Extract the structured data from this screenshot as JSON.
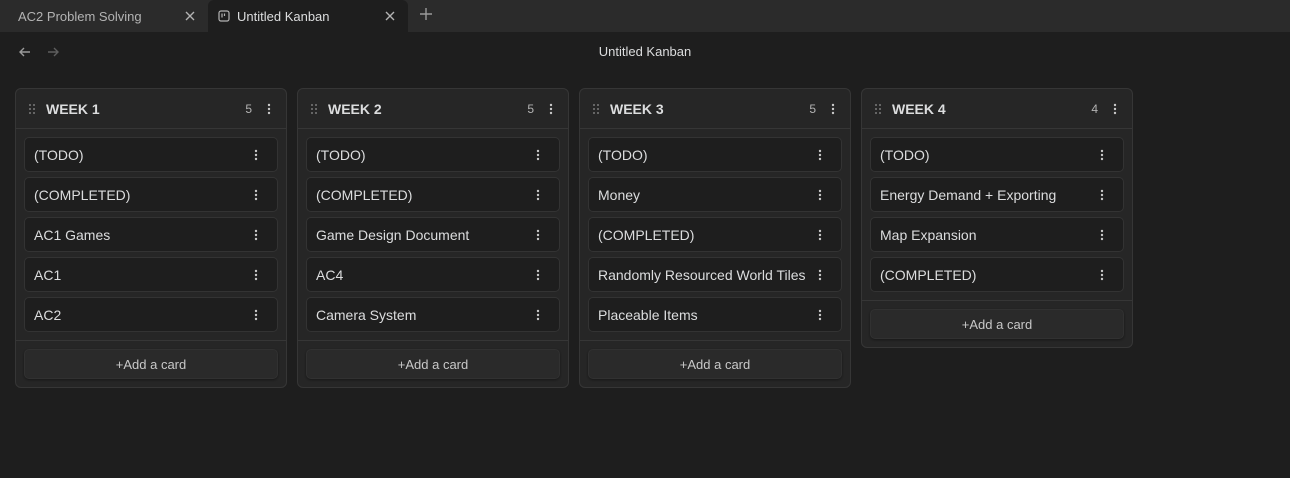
{
  "tabs": [
    {
      "label": "AC2 Problem Solving",
      "active": false
    },
    {
      "label": "Untitled Kanban",
      "active": true
    }
  ],
  "header": {
    "title": "Untitled Kanban"
  },
  "add_card_label": "+Add a card",
  "lanes": [
    {
      "title": "WEEK 1",
      "count": "5",
      "cards": [
        "(TODO)",
        "(COMPLETED)",
        "AC1 Games",
        "AC1",
        "AC2"
      ]
    },
    {
      "title": "WEEK 2",
      "count": "5",
      "cards": [
        "(TODO)",
        "(COMPLETED)",
        "Game Design Document",
        "AC4",
        "Camera System"
      ]
    },
    {
      "title": "WEEK 3",
      "count": "5",
      "cards": [
        "(TODO)",
        "Money",
        "(COMPLETED)",
        "Randomly Resourced World Tiles",
        "Placeable Items"
      ]
    },
    {
      "title": "WEEK 4",
      "count": "4",
      "cards": [
        "(TODO)",
        "Energy Demand + Exporting",
        "Map Expansion",
        "(COMPLETED)"
      ]
    }
  ],
  "icons": {
    "close": "close-icon",
    "kanban": "kanban-icon",
    "new_tab": "plus-icon",
    "back": "arrow-left-icon",
    "forward": "arrow-right-icon",
    "grip": "grip-icon",
    "more": "more-vertical-icon"
  },
  "colors": {
    "background": "#1e1e1e",
    "tabbar": "#2b2b2b",
    "lane": "#262626",
    "text": "#dcddde"
  }
}
